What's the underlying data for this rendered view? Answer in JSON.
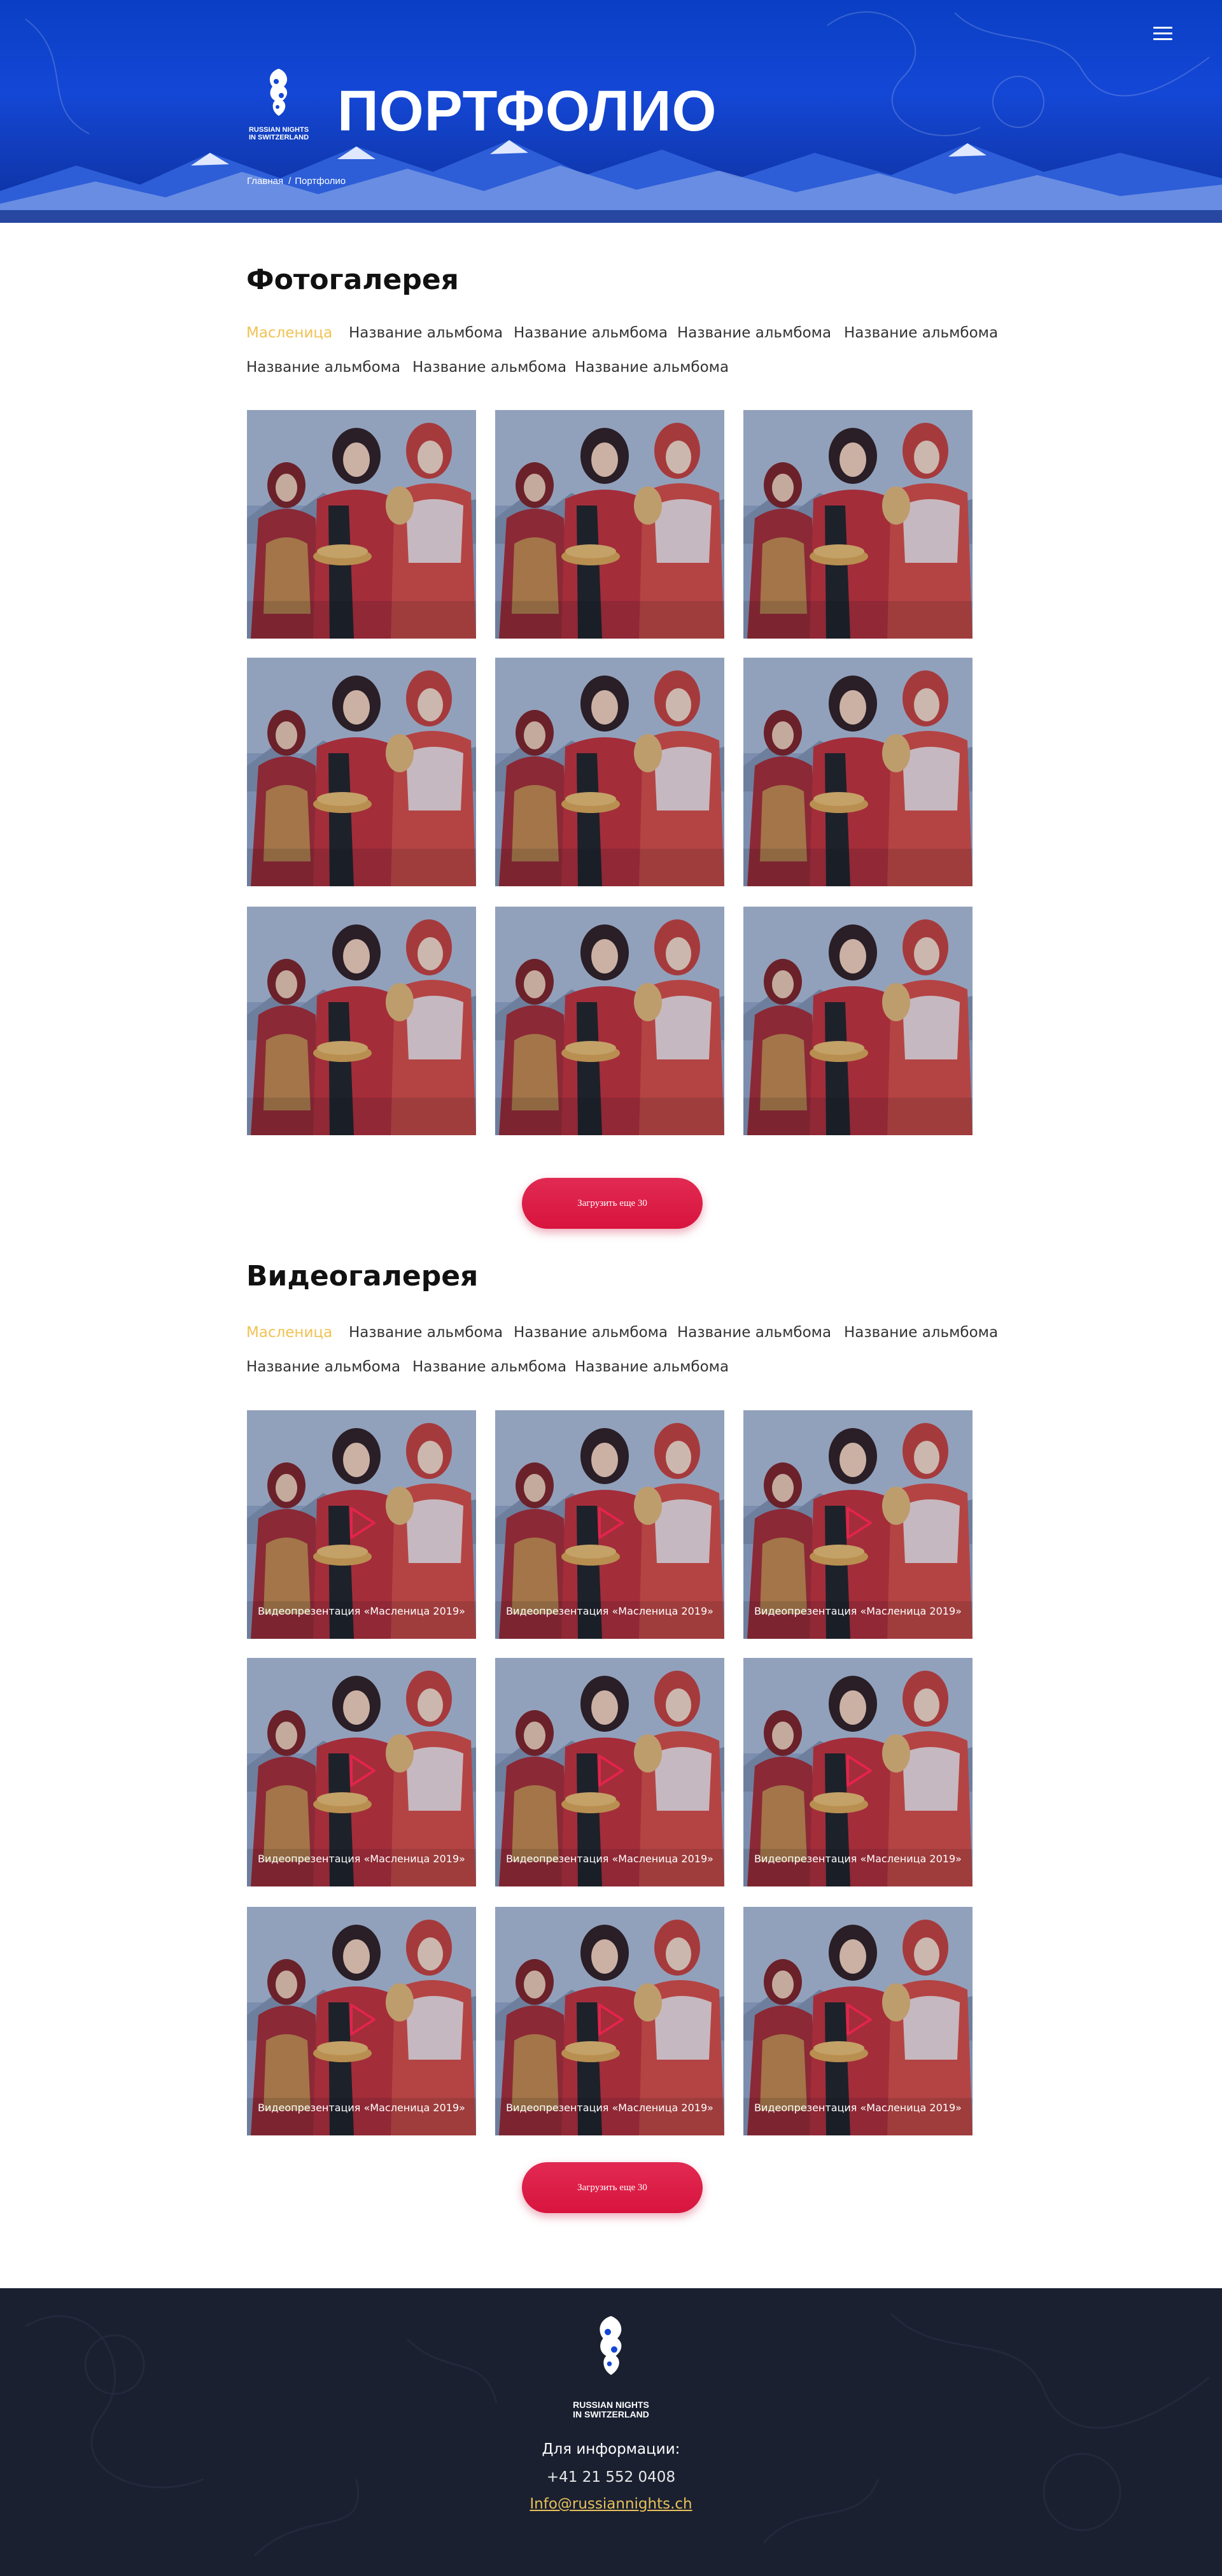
{
  "header": {
    "title": "ПОРТФОЛИО",
    "logo_text_line1": "RUSSIAN NIGHTS",
    "logo_text_line2": "IN SWITZERLAND",
    "breadcrumb": {
      "home": "Главная",
      "separator": "/",
      "current": "Портфолио"
    },
    "menu_icon": "hamburger-icon",
    "colors": {
      "hero_blue": "#1447d6",
      "white": "#ffffff"
    }
  },
  "photo_gallery": {
    "title": "Фотогалерея",
    "tabs": [
      {
        "label": "Масленица",
        "active": true
      },
      {
        "label": "Название альмбома",
        "active": false
      },
      {
        "label": "Название альмбома",
        "active": false
      },
      {
        "label": "Название альмбома",
        "active": false
      },
      {
        "label": "Название альмбома",
        "active": false
      },
      {
        "label": "Название альмбома",
        "active": false
      },
      {
        "label": "Название альмбома",
        "active": false
      },
      {
        "label": "Название альмбома",
        "active": false
      }
    ],
    "items_count": 9,
    "load_more_label": "Загрузить еще 30"
  },
  "video_gallery": {
    "title": "Видеогалерея",
    "tabs": [
      {
        "label": "Масленица",
        "active": true
      },
      {
        "label": "Название альмбома",
        "active": false
      },
      {
        "label": "Название альмбома",
        "active": false
      },
      {
        "label": "Название альмбома",
        "active": false
      },
      {
        "label": "Название альмбома",
        "active": false
      },
      {
        "label": "Название альмбома",
        "active": false
      },
      {
        "label": "Название альмбома",
        "active": false
      },
      {
        "label": "Название альмбома",
        "active": false
      }
    ],
    "items": [
      {
        "caption": "Видеопрезентация «Масленица 2019»"
      },
      {
        "caption": "Видеопрезентация «Масленица 2019»"
      },
      {
        "caption": "Видеопрезентация «Масленица 2019»"
      },
      {
        "caption": "Видеопрезентация «Масленица 2019»"
      },
      {
        "caption": "Видеопрезентация «Масленица 2019»"
      },
      {
        "caption": "Видеопрезентация «Масленица 2019»"
      },
      {
        "caption": "Видеопрезентация «Масленица 2019»"
      },
      {
        "caption": "Видеопрезентация «Масленица 2019»"
      },
      {
        "caption": "Видеопрезентация «Масленица 2019»"
      }
    ],
    "play_icon": "play-icon",
    "load_more_label": "Загрузить еще 30"
  },
  "footer": {
    "logo_text_line1": "RUSSIAN NIGHTS",
    "logo_text_line2": "IN SWITZERLAND",
    "info_label": "Для информации:",
    "phone": "+41 21 552 0408",
    "email": "Info@russiannights.ch",
    "colors": {
      "background": "#1a2030",
      "email": "#e8c05a"
    }
  },
  "colors": {
    "accent_active_tab": "#f0c254",
    "button": "#dc1c45"
  }
}
